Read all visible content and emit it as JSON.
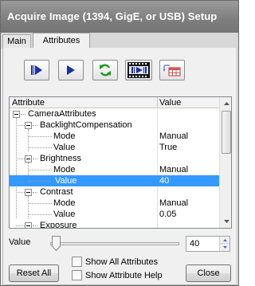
{
  "window": {
    "title": "Acquire Image (1394, GigE, or USB) Setup"
  },
  "tabs": [
    {
      "label": "Main",
      "active": false
    },
    {
      "label": "Attributes",
      "active": true
    }
  ],
  "toolbar": {
    "buttons": [
      {
        "name": "step-frame-button",
        "icon": "step-play-icon"
      },
      {
        "name": "play-button",
        "icon": "play-icon"
      },
      {
        "name": "refresh-button",
        "icon": "refresh-icon"
      },
      {
        "name": "filmstrip-button",
        "icon": "filmstrip-icon"
      },
      {
        "name": "send-attributes-button",
        "icon": "send-grid-icon"
      }
    ]
  },
  "grid": {
    "headers": {
      "attribute": "Attribute",
      "value": "Value"
    },
    "rows": [
      {
        "label": "CameraAttributes",
        "value": "",
        "depth": 0,
        "expandable": true,
        "selected": false
      },
      {
        "label": "BacklightCompensation",
        "value": "",
        "depth": 1,
        "expandable": true,
        "selected": false
      },
      {
        "label": "Mode",
        "value": "Manual",
        "depth": 2,
        "expandable": false,
        "selected": false
      },
      {
        "label": "Value",
        "value": "True",
        "depth": 2,
        "expandable": false,
        "selected": false
      },
      {
        "label": "Brightness",
        "value": "",
        "depth": 1,
        "expandable": true,
        "selected": false
      },
      {
        "label": "Mode",
        "value": "Manual",
        "depth": 2,
        "expandable": false,
        "selected": false
      },
      {
        "label": "Value",
        "value": "40",
        "depth": 2,
        "expandable": false,
        "selected": true
      },
      {
        "label": "Contrast",
        "value": "",
        "depth": 1,
        "expandable": true,
        "selected": false
      },
      {
        "label": "Mode",
        "value": "Manual",
        "depth": 2,
        "expandable": false,
        "selected": false
      },
      {
        "label": "Value",
        "value": "0.05",
        "depth": 2,
        "expandable": false,
        "selected": false
      },
      {
        "label": "Exposure",
        "value": "",
        "depth": 1,
        "expandable": true,
        "selected": false
      }
    ]
  },
  "value_control": {
    "label": "Value",
    "current": "40",
    "slider_fraction": 0.05
  },
  "buttons": {
    "reset_all": "Reset All",
    "close": "Close"
  },
  "checkboxes": {
    "show_all": {
      "label": "Show All Attributes",
      "checked": false
    },
    "show_help": {
      "label": "Show Attribute Help",
      "checked": false
    }
  },
  "colors": {
    "selection": "#3399ff",
    "icon_blue": "#1a2fa8",
    "icon_green": "#1f9a1f"
  }
}
